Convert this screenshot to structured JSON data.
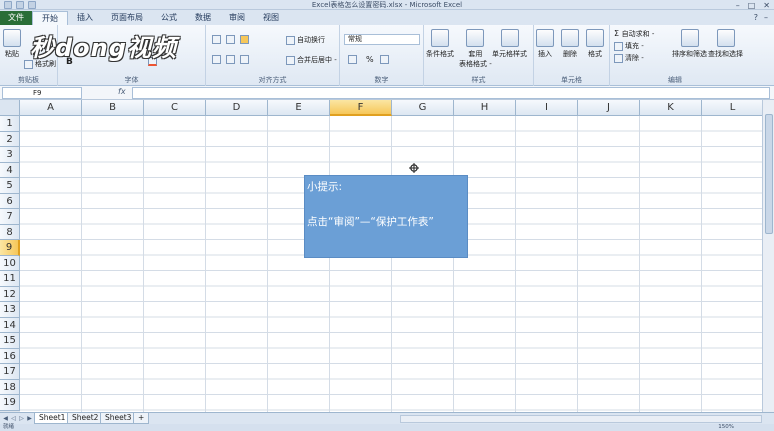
{
  "window": {
    "title": "Excel表格怎么设置密码.xlsx - Microsoft Excel"
  },
  "tabs": [
    "文件",
    "开始",
    "插入",
    "页面布局",
    "公式",
    "数据",
    "审阅",
    "视图"
  ],
  "ribbon": {
    "clipboard": {
      "label": "剪贴板",
      "paste": "粘贴",
      "format_painter": "格式刷"
    },
    "font": {
      "label": "字体"
    },
    "alignment": {
      "label": "对齐方式",
      "wrap": "自动换行",
      "merge": "合并后居中 -"
    },
    "number": {
      "label": "数字",
      "format": "常规",
      "percent": "%"
    },
    "styles": {
      "label": "样式",
      "conditional": "条件格式",
      "as_table_l1": "套用",
      "as_table_l2": "表格格式 -",
      "cell_styles": "单元格样式"
    },
    "cells": {
      "label": "单元格",
      "insert": "插入",
      "delete": "删除",
      "format": "格式"
    },
    "editing": {
      "label": "编辑",
      "autosum": "自动求和 -",
      "fill": "填充 -",
      "clear": "清除 -",
      "sort_filter": "排序和筛选",
      "find_select": "查找和选择"
    }
  },
  "watermark": "秒dong视频",
  "formula_bar": {
    "name_box": "F9",
    "fx": "fx",
    "content": ""
  },
  "columns": [
    "A",
    "B",
    "C",
    "D",
    "E",
    "F",
    "G",
    "H",
    "I",
    "J",
    "K",
    "L"
  ],
  "rows": [
    "1",
    "2",
    "3",
    "4",
    "5",
    "6",
    "7",
    "8",
    "9",
    "10",
    "11",
    "12",
    "13",
    "14",
    "15",
    "16",
    "17",
    "18",
    "19"
  ],
  "selected": {
    "column": "F",
    "row": "9"
  },
  "tip": {
    "title": "小提示:",
    "body": "点击“审阅”—“保护工作表”"
  },
  "sheets": [
    "Sheet1",
    "Sheet2",
    "Sheet3"
  ],
  "active_sheet": "Sheet1",
  "status": {
    "left": "就绪",
    "zoom": "150%"
  },
  "colors": {
    "tip_bg": "#6b9fd6",
    "selected_header": "#f6c75a",
    "file_tab": "#2a6e37"
  }
}
